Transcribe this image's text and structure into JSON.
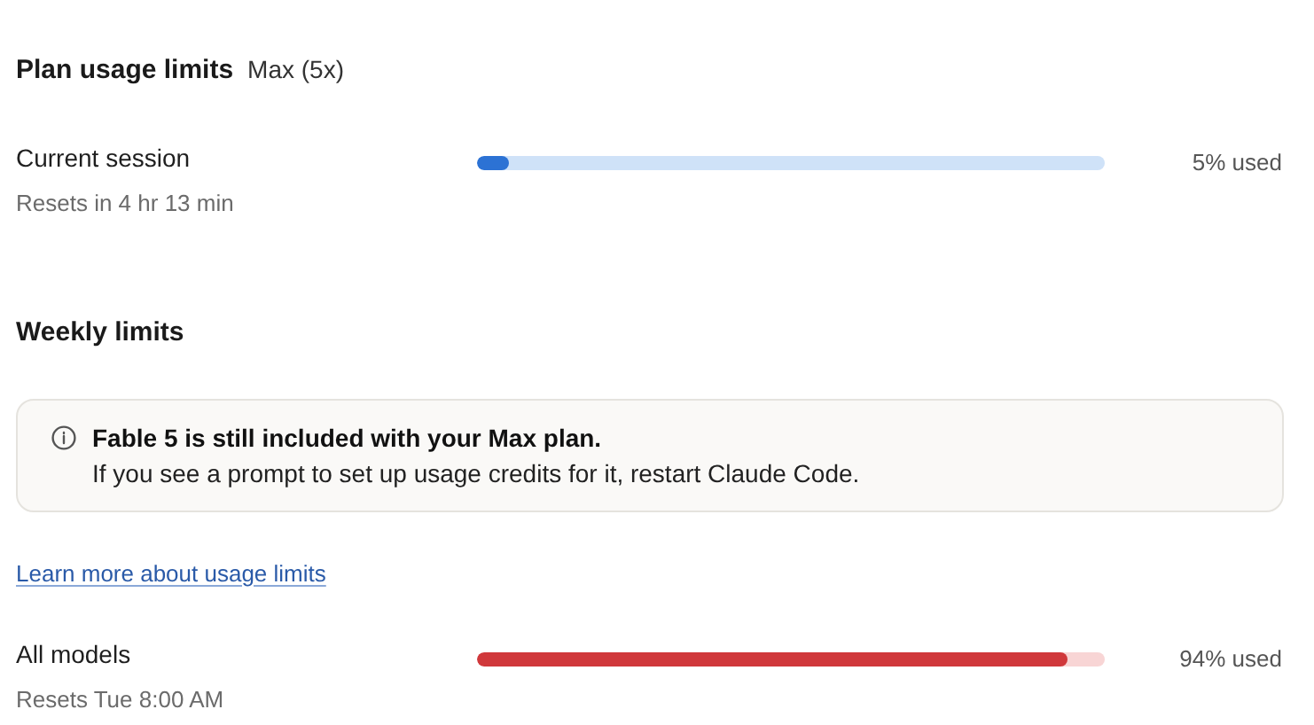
{
  "header": {
    "title": "Plan usage limits",
    "plan": "Max (5x)"
  },
  "session_meter": {
    "kind": "normal",
    "name": "Current session",
    "reset": "Resets in 4 hr 13 min",
    "level": 0.05,
    "reading": "5% used"
  },
  "weekly": {
    "title": "Weekly limits",
    "notice": {
      "heading": "Fable 5 is still included with your Max plan.",
      "body": "If you see a prompt to set up usage credits for it, restart Claude Code."
    },
    "link": "Learn more about usage limits",
    "meters": [
      {
        "kind": "critical",
        "name": "All models",
        "reset": "Resets Tue 8:00 AM",
        "level": 0.94,
        "reading": "94% used"
      }
    ]
  }
}
